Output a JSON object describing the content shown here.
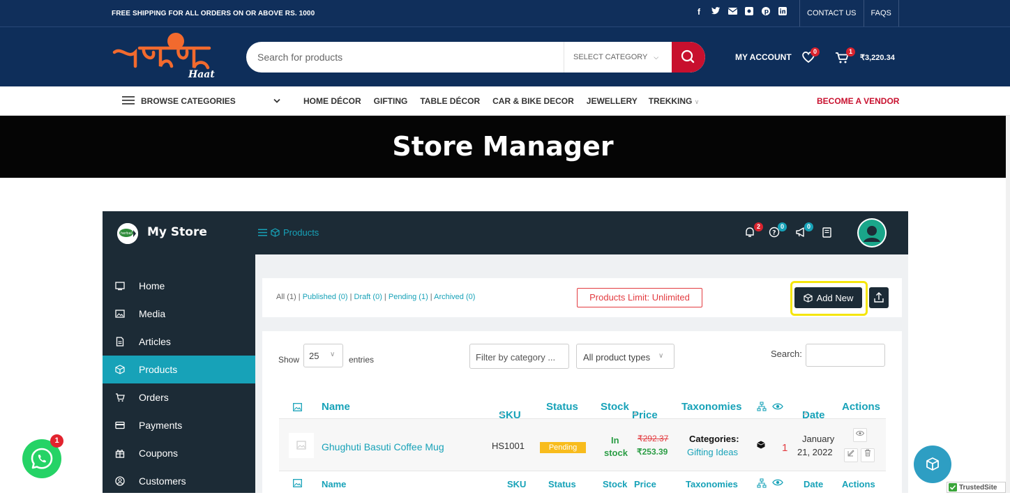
{
  "topbar": {
    "shipping_text": "FREE SHIPPING FOR ALL ORDERS ON OR ABOVE RS. 1000",
    "contact_label": "CONTACT US",
    "faqs_label": "FAQS"
  },
  "header": {
    "search_placeholder": "Search for products",
    "category_label": "SELECT CATEGORY",
    "account_label": "MY ACCOUNT",
    "wishlist_count": "0",
    "cart_count": "1",
    "cart_total": "₹3,220.34",
    "accent_color": "#c8102e"
  },
  "nav": {
    "browse_label": "BROWSE CATEGORIES",
    "items": [
      "HOME DÉCOR",
      "GIFTING",
      "TABLE DÉCOR",
      "CAR & BIKE DECOR",
      "JEWELLERY",
      "TREKKING"
    ],
    "vendor_label": "BECOME A VENDOR"
  },
  "banner": {
    "title": "Store Manager"
  },
  "store": {
    "name": "My Store",
    "breadcrumb": "Products",
    "notifications": "2",
    "help": "0",
    "announcements": "0",
    "sidebar": [
      {
        "label": "Home",
        "icon": "monitor-icon"
      },
      {
        "label": "Media",
        "icon": "image-icon"
      },
      {
        "label": "Articles",
        "icon": "document-icon"
      },
      {
        "label": "Products",
        "icon": "cube-icon",
        "active": true
      },
      {
        "label": "Orders",
        "icon": "cart-icon"
      },
      {
        "label": "Payments",
        "icon": "card-icon"
      },
      {
        "label": "Coupons",
        "icon": "gift-icon"
      },
      {
        "label": "Customers",
        "icon": "user-icon"
      }
    ]
  },
  "products": {
    "filters": {
      "all": "All (1)",
      "published": "Published (0)",
      "draft": "Draft (0)",
      "pending": "Pending (1)",
      "archived": "Archived (0)"
    },
    "limit_label": "Products Limit: Unlimited",
    "add_new_label": "Add New",
    "show_label": "Show",
    "entries_value": "25",
    "entries_label": "entries",
    "category_filter_placeholder": "Filter by category ...",
    "type_filter": "All product types",
    "search_label": "Search:",
    "columns": [
      "Name",
      "SKU",
      "Status",
      "Stock",
      "Price",
      "Taxonomies",
      "Date",
      "Actions"
    ],
    "rows": [
      {
        "name": "Ghughuti Basuti Coffee Mug",
        "sku": "HS1001",
        "status": "Pending",
        "stock_line1": "In",
        "stock_line2": "stock",
        "price_old": "₹292.37",
        "price_new": "₹253.39",
        "categories_label": "Categories",
        "category": "Gifting Ideas",
        "views": "1",
        "date_line1": "January",
        "date_line2": "21, 2022"
      }
    ]
  },
  "floating": {
    "whatsapp_badge": "1",
    "trusted_label": "TrustedSite"
  }
}
